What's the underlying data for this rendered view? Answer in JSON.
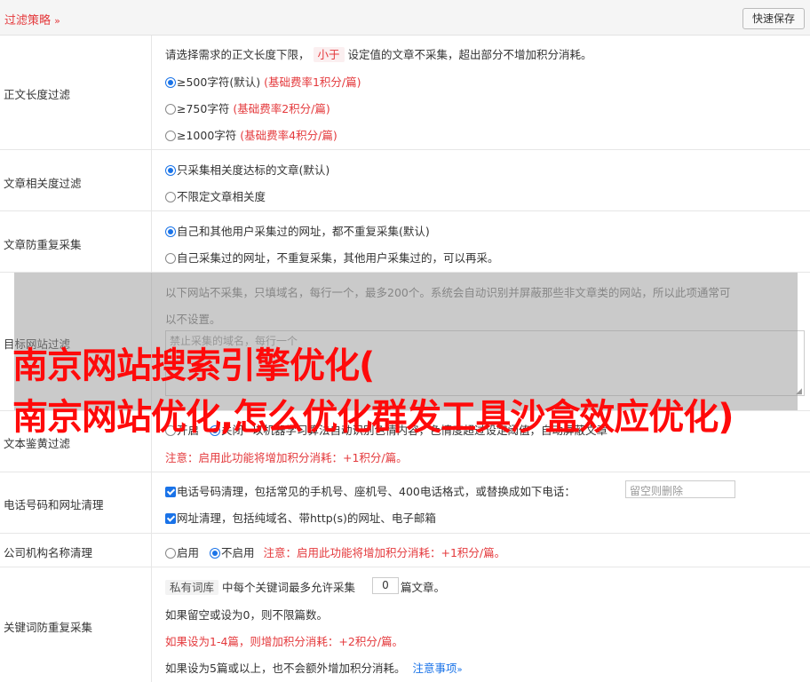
{
  "topbar": {
    "title": "过滤策略",
    "save_label": "快速保存"
  },
  "rows": {
    "length": {
      "label": "正文长度过滤",
      "desc_pre": "请选择需求的正文长度下限，",
      "desc_tag": "小于",
      "desc_post": "设定值的文章不采集，超出部分不增加积分消耗。",
      "opt1": "≥500字符(默认)",
      "opt1_note": "(基础费率1积分/篇)",
      "opt2": "≥750字符",
      "opt2_note": "(基础费率2积分/篇)",
      "opt3": "≥1000字符",
      "opt3_note": "(基础费率4积分/篇)"
    },
    "relevance": {
      "label": "文章相关度过滤",
      "opt1": "只采集相关度达标的文章(默认)",
      "opt2": "不限定文章相关度"
    },
    "dedupe": {
      "label": "文章防重复采集",
      "opt1": "自己和其他用户采集过的网址，都不重复采集(默认)",
      "opt2": "自己采集过的网址，不重复采集，其他用户采集过的，可以再采。"
    },
    "site": {
      "label": "目标网站过滤",
      "desc1": "以下网站不采集，只填域名，每行一个，最多200个。系统会自动识别并屏蔽那些非文章类的网站，所以此项通常可",
      "desc2": "以不设置。",
      "placeholder": "禁止采集的域名，每行一个"
    },
    "porn": {
      "label": "文本鉴黄过滤",
      "opt_on": "开启",
      "opt_off": "关闭",
      "desc": "以机器学习算法自动识别色情内容，色情度超过设定阈值，自动屏蔽文章",
      "note": "注意：启用此功能将增加积分消耗：+1积分/篇。"
    },
    "phone": {
      "label": "电话号码和网址清理",
      "opt1": "电话号码清理，包括常见的手机号、座机号、400电话格式，或替换成如下电话：",
      "placeholder": "留空则删除",
      "opt2": "网址清理，包括纯域名、带http(s)的网址、电子邮箱"
    },
    "company": {
      "label": "公司机构名称清理",
      "opt_on": "启用",
      "opt_off": "不启用",
      "note": "注意：启用此功能将增加积分消耗：+1积分/篇。"
    },
    "keyword": {
      "label": "关键词防重复采集",
      "tag": "私有词库",
      "desc_pre": "中每个关键词最多允许采集",
      "count": "0",
      "desc_post": "篇文章。",
      "line2": "如果留空或设为0，则不限篇数。",
      "line3": "如果设为1-4篇，则增加积分消耗：+2积分/篇。",
      "line4": "如果设为5篇或以上，也不会额外增加积分消耗。",
      "link": "注意事项"
    }
  },
  "overlay": {
    "line1": "南京网站搜索引擎优化(",
    "line2": "南京网站优化,怎么优化群发工具沙盒效应优化)"
  },
  "colors": {
    "accent": "#e4393c",
    "link": "#1a73e8",
    "overlay_text": "#ff0a0a"
  }
}
